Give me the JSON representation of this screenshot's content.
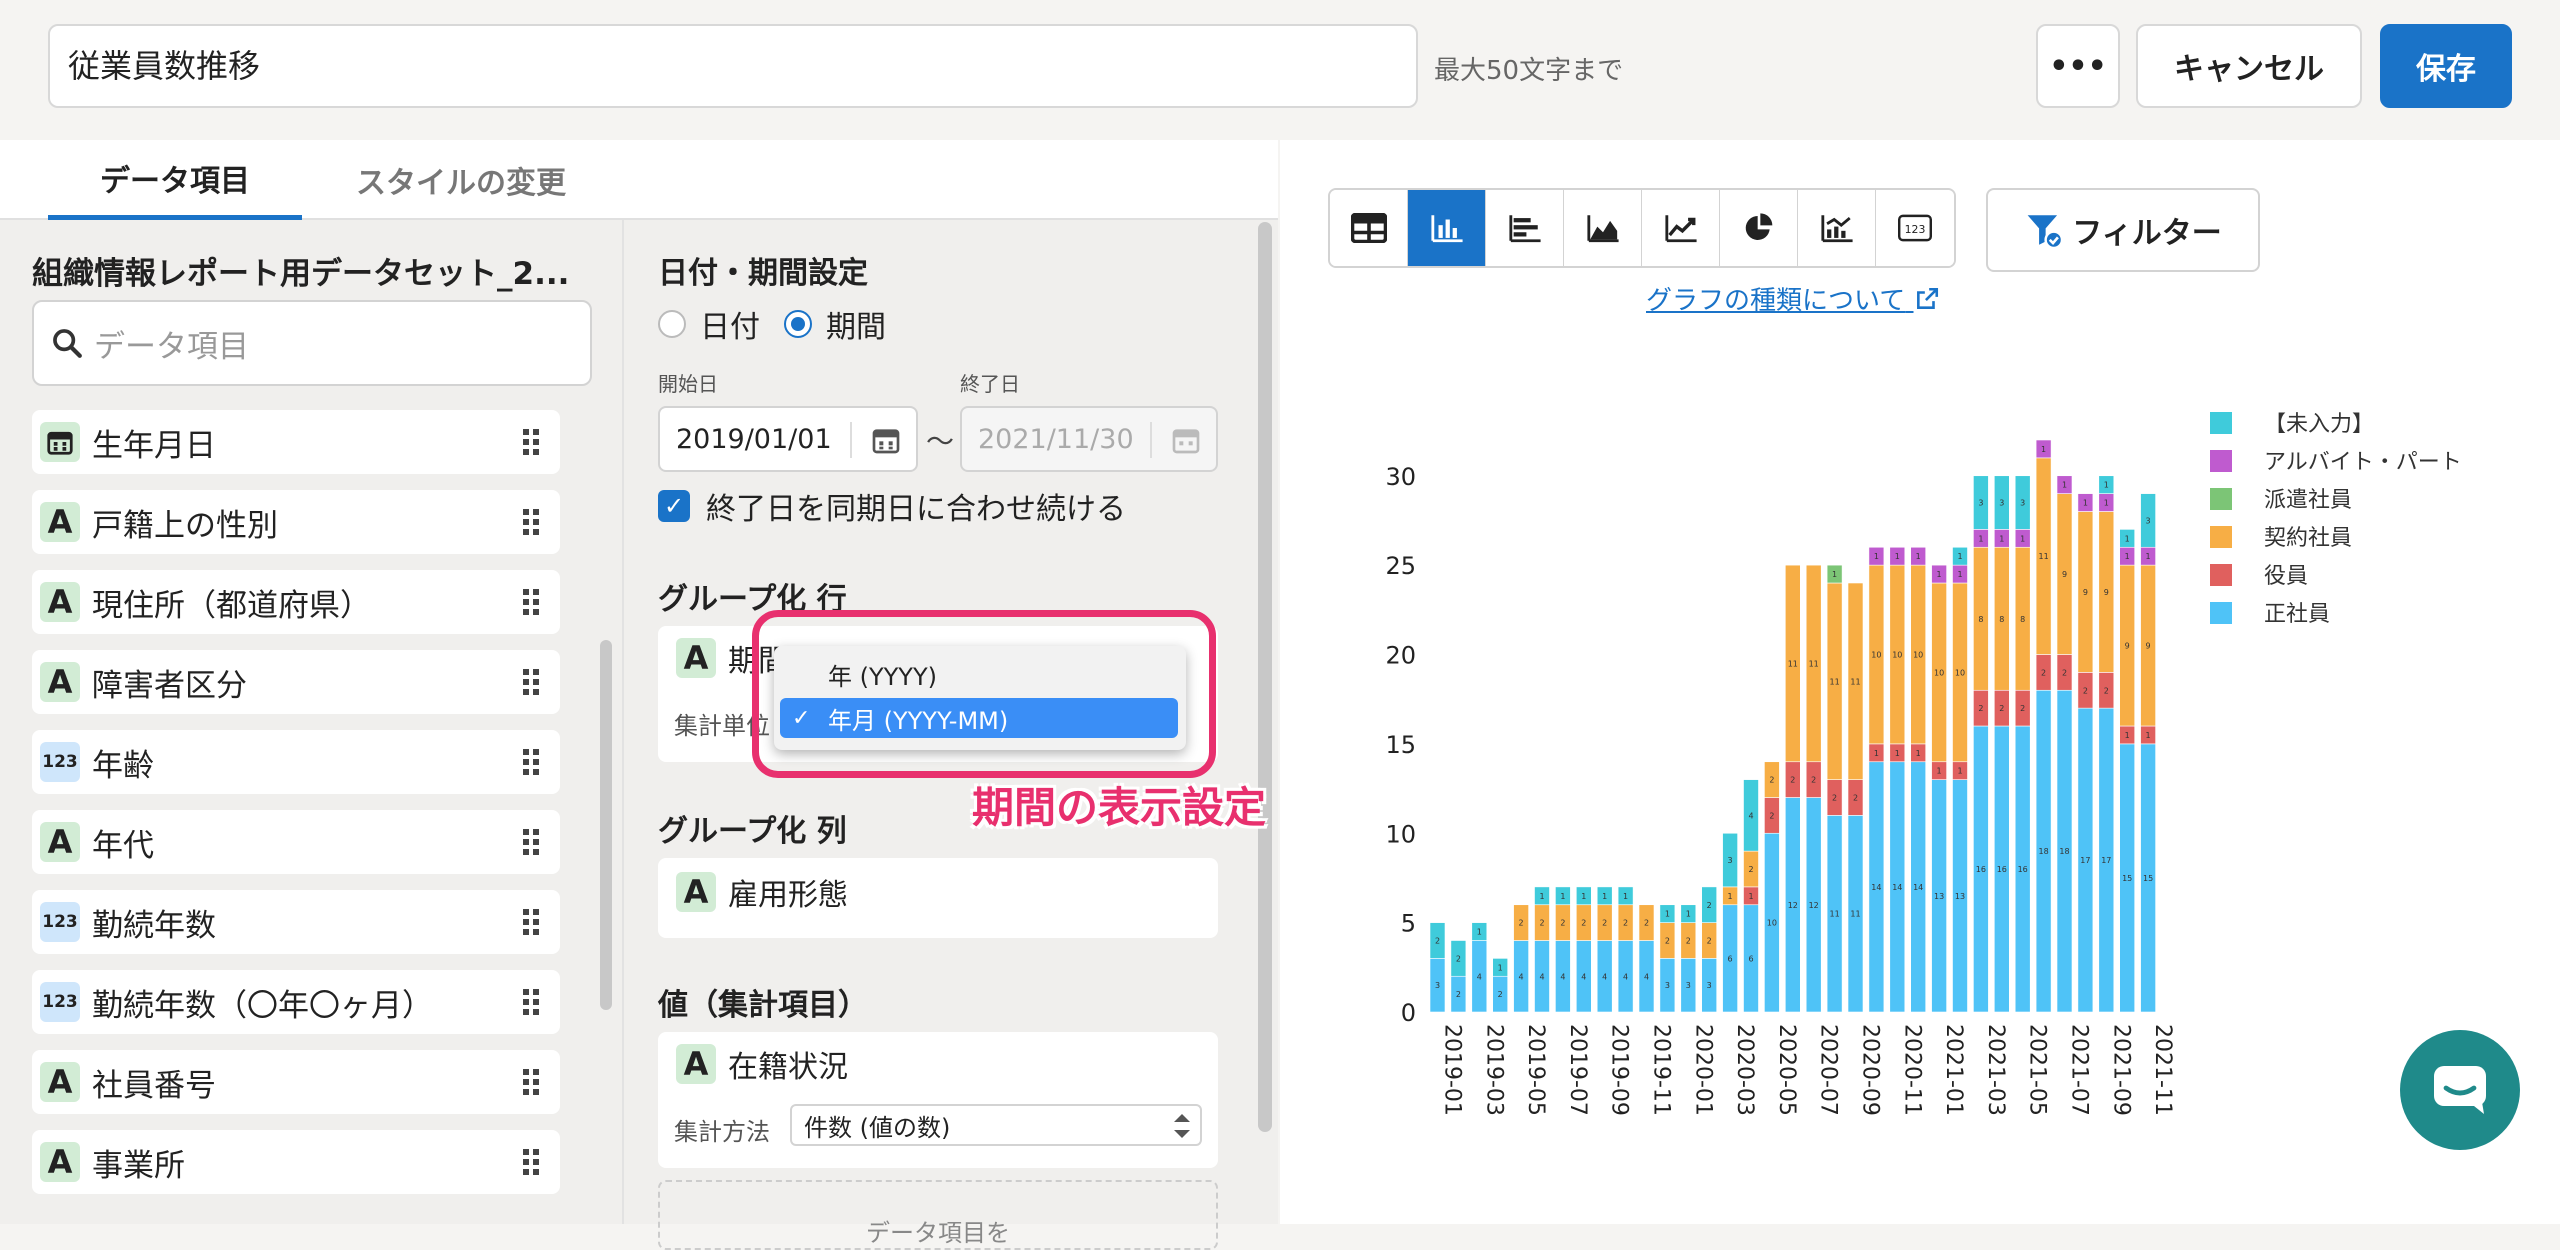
{
  "header": {
    "title_value": "従業員数推移",
    "hint": "最大50文字まで",
    "more_label": "•••",
    "cancel_label": "キャンセル",
    "save_label": "保存"
  },
  "tabs": [
    "データ項目",
    "スタイルの変更"
  ],
  "dataset": {
    "name": "組織情報レポート用データセット_2...",
    "search_placeholder": "データ項目",
    "fields": [
      {
        "label": "生年月日",
        "type": "calendar"
      },
      {
        "label": "戸籍上の性別",
        "type": "text",
        "icon": "A"
      },
      {
        "label": "現住所（都道府県）",
        "type": "text",
        "icon": "A"
      },
      {
        "label": "障害者区分",
        "type": "text",
        "icon": "A"
      },
      {
        "label": "年齢",
        "type": "number",
        "icon": "123"
      },
      {
        "label": "年代",
        "type": "text",
        "icon": "A"
      },
      {
        "label": "勤続年数",
        "type": "number",
        "icon": "123"
      },
      {
        "label": "勤続年数（〇年〇ヶ月）",
        "type": "number",
        "icon": "123"
      },
      {
        "label": "社員番号",
        "type": "text",
        "icon": "A"
      },
      {
        "label": "事業所",
        "type": "text",
        "icon": "A"
      }
    ]
  },
  "settings": {
    "date_title": "日付・期間設定",
    "radio_date": "日付",
    "radio_period": "期間",
    "start_label": "開始日",
    "end_label": "終了日",
    "start_value": "2019/01/01",
    "tilde": "〜",
    "end_value": "2021/11/30",
    "keep_end_label": "終了日を同期日に合わせ続ける",
    "group_row_title": "グループ化 行",
    "group_row_field_icon": "A",
    "group_row_field": "期間",
    "agg_unit_label": "集計単位",
    "group_col_title": "グループ化 列",
    "group_col_field_icon": "A",
    "group_col_field": "雇用形態",
    "value_title": "値（集計項目）",
    "value_field_icon": "A",
    "value_field": "在籍状況",
    "agg_method_label": "集計方法",
    "agg_method_value": "件数 (値の数)",
    "drop_hint": "データ項目を"
  },
  "dropdown": {
    "options": [
      "年 (YYYY)",
      "年月 (YYYY-MM)"
    ],
    "selected_index": 1,
    "check": "✓"
  },
  "annotation": "期間の表示設定",
  "chart_panel": {
    "chart_types": [
      "table-icon",
      "bar-chart-icon",
      "horizontal-bar-icon",
      "area-chart-icon",
      "line-chart-icon",
      "pie-chart-icon",
      "combo-chart-icon",
      "number-icon"
    ],
    "selected_type": 1,
    "filter_label": "フィルター",
    "graph_link": "グラフの種類について"
  },
  "chart_data": {
    "type": "bar",
    "stacked": true,
    "categories": [
      "2019-01",
      "2019-02",
      "2019-03",
      "2019-04",
      "2019-05",
      "2019-06",
      "2019-07",
      "2019-08",
      "2019-09",
      "2019-10",
      "2019-11",
      "2019-12",
      "2020-01",
      "2020-02",
      "2020-03",
      "2020-04",
      "2020-05",
      "2020-06",
      "2020-07",
      "2020-08",
      "2020-09",
      "2020-10",
      "2020-11",
      "2020-12",
      "2021-01",
      "2021-02",
      "2021-03",
      "2021-04",
      "2021-05",
      "2021-06",
      "2021-07",
      "2021-08",
      "2021-09",
      "2021-10",
      "2021-11"
    ],
    "x_tick_labels": [
      "2019-01",
      "2019-03",
      "2019-05",
      "2019-07",
      "2019-09",
      "2019-11",
      "2020-01",
      "2020-03",
      "2020-05",
      "2020-07",
      "2020-09",
      "2020-11",
      "2021-01",
      "2021-03",
      "2021-05",
      "2021-07",
      "2021-09",
      "2021-11"
    ],
    "ylim": [
      0,
      32
    ],
    "yticks": [
      0,
      5,
      10,
      15,
      20,
      25,
      30
    ],
    "series": [
      {
        "name": "正社員",
        "color": "#4fc3f7",
        "values": [
          3,
          2,
          4,
          2,
          4,
          4,
          4,
          4,
          4,
          4,
          4,
          3,
          3,
          3,
          6,
          6,
          10,
          12,
          12,
          11,
          11,
          14,
          14,
          14,
          13,
          13,
          16,
          16,
          16,
          18,
          18,
          17,
          17,
          15,
          15
        ]
      },
      {
        "name": "役員",
        "color": "#e0605e",
        "values": [
          0,
          0,
          0,
          0,
          0,
          0,
          0,
          0,
          0,
          0,
          0,
          0,
          0,
          0,
          0,
          1,
          2,
          2,
          2,
          2,
          2,
          1,
          1,
          1,
          1,
          1,
          2,
          2,
          2,
          2,
          2,
          2,
          2,
          1,
          1
        ]
      },
      {
        "name": "契約社員",
        "color": "#f7ae45",
        "values": [
          0,
          0,
          0,
          0,
          2,
          2,
          2,
          2,
          2,
          2,
          2,
          2,
          2,
          2,
          1,
          2,
          2,
          11,
          11,
          11,
          11,
          10,
          10,
          10,
          10,
          10,
          8,
          8,
          8,
          11,
          9,
          9,
          9,
          9,
          9
        ]
      },
      {
        "name": "派遣社員",
        "color": "#7cc576",
        "values": [
          0,
          0,
          0,
          0,
          0,
          0,
          0,
          0,
          0,
          0,
          0,
          0,
          0,
          0,
          0,
          0,
          0,
          0,
          0,
          1,
          0,
          0,
          0,
          0,
          0,
          0,
          0,
          0,
          0,
          0,
          0,
          0,
          0,
          0,
          0
        ]
      },
      {
        "name": "アルバイト・パート",
        "color": "#bf5bcf",
        "values": [
          0,
          0,
          0,
          0,
          0,
          0,
          0,
          0,
          0,
          0,
          0,
          0,
          0,
          0,
          0,
          0,
          0,
          0,
          0,
          0,
          0,
          1,
          1,
          1,
          1,
          1,
          1,
          1,
          1,
          1,
          1,
          1,
          1,
          1,
          1
        ]
      },
      {
        "name": "【未入力】",
        "color": "#3fcbdb",
        "values": [
          2,
          2,
          1,
          1,
          0,
          1,
          1,
          1,
          1,
          1,
          0,
          1,
          1,
          2,
          3,
          4,
          0,
          0,
          0,
          0,
          0,
          0,
          0,
          0,
          0,
          1,
          3,
          3,
          3,
          0,
          0,
          0,
          1,
          1,
          3
        ]
      }
    ],
    "legend_order": [
      "【未入力】",
      "アルバイト・パート",
      "派遣社員",
      "契約社員",
      "役員",
      "正社員"
    ],
    "legend_placement": "right"
  }
}
